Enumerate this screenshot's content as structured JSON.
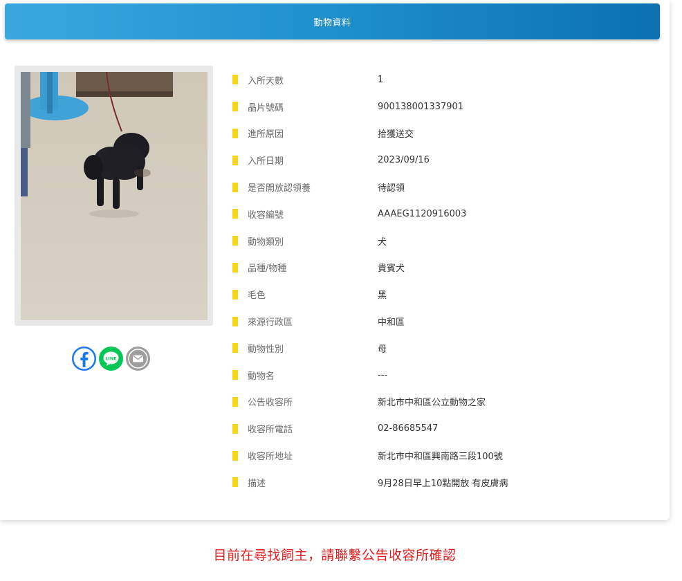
{
  "header": {
    "title": "動物資料"
  },
  "share": {
    "facebook_icon": "facebook-icon",
    "line_icon": "line-icon",
    "line_text": "LINE",
    "mail_icon": "mail-icon"
  },
  "details": [
    {
      "label": "入所天數",
      "value": "1"
    },
    {
      "label": "晶片號碼",
      "value": "900138001337901"
    },
    {
      "label": "進所原因",
      "value": "拾獲送交"
    },
    {
      "label": "入所日期",
      "value": "2023/09/16"
    },
    {
      "label": "是否開放認領養",
      "value": "待認領"
    },
    {
      "label": "收容編號",
      "value": "AAAEG1120916003"
    },
    {
      "label": "動物類別",
      "value": "犬"
    },
    {
      "label": "品種/物種",
      "value": "貴賓犬"
    },
    {
      "label": "毛色",
      "value": "黑"
    },
    {
      "label": "來源行政區",
      "value": "中和區"
    },
    {
      "label": "動物性別",
      "value": "母"
    },
    {
      "label": "動物名",
      "value": "---"
    },
    {
      "label": "公告收容所",
      "value": "新北市中和區公立動物之家"
    },
    {
      "label": "收容所電話",
      "value": "02-86685547"
    },
    {
      "label": "收容所地址",
      "value": "新北市中和區興南路三段100號"
    },
    {
      "label": "描述",
      "value": "9月28日早上10點開放 有皮膚病"
    }
  ],
  "notice": {
    "text": "目前在尋找飼主，請聯繫公告收容所確認"
  },
  "colors": {
    "header_start": "#3aa8df",
    "header_end": "#0b71b0",
    "marker": "#f7d417",
    "notice": "#e02020",
    "facebook": "#1877f2",
    "line": "#06c755",
    "mail": "#9e9e9e"
  }
}
